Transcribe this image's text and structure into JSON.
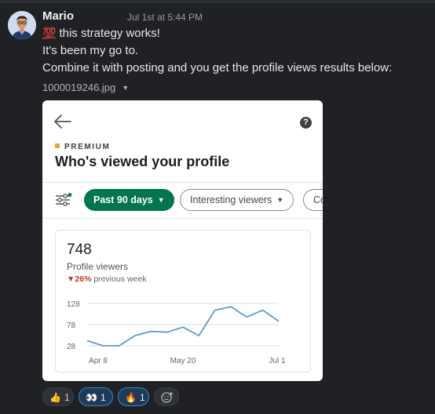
{
  "message": {
    "author": "Mario",
    "timestamp": "Jul 1st at 5:44 PM",
    "emoji": "💯",
    "line1": "this strategy works!",
    "line2": "It's been my go to.",
    "line3": "Combine it with posting and you get the profile views results below:",
    "attachment_name": "1000019246.jpg"
  },
  "screenshot": {
    "premium_label": "PREMIUM",
    "title": "Who's viewed your profile",
    "help_icon": "?",
    "filters": {
      "active": "Past 90 days",
      "second": "Interesting viewers",
      "third": "Co"
    },
    "card": {
      "count": "748",
      "label": "Profile viewers",
      "delta_value": "26%",
      "delta_text": "previous week"
    }
  },
  "chart_data": {
    "type": "line",
    "ylim": [
      28,
      128
    ],
    "yticks": [
      "128",
      "78",
      "28"
    ],
    "x_tick_labels": [
      "Apr 8",
      "May 20",
      "Jul 1"
    ],
    "series": [
      {
        "values": [
          40,
          28,
          28,
          52,
          62,
          60,
          72,
          52,
          112,
          120,
          96,
          112,
          86
        ]
      }
    ],
    "color": "#5b9bd5",
    "grid": true
  },
  "reactions": [
    {
      "emoji": "👍",
      "count": "1",
      "active": false
    },
    {
      "emoji": "👀",
      "count": "1",
      "active": true
    },
    {
      "emoji": "🔥",
      "count": "1",
      "active": true
    }
  ]
}
